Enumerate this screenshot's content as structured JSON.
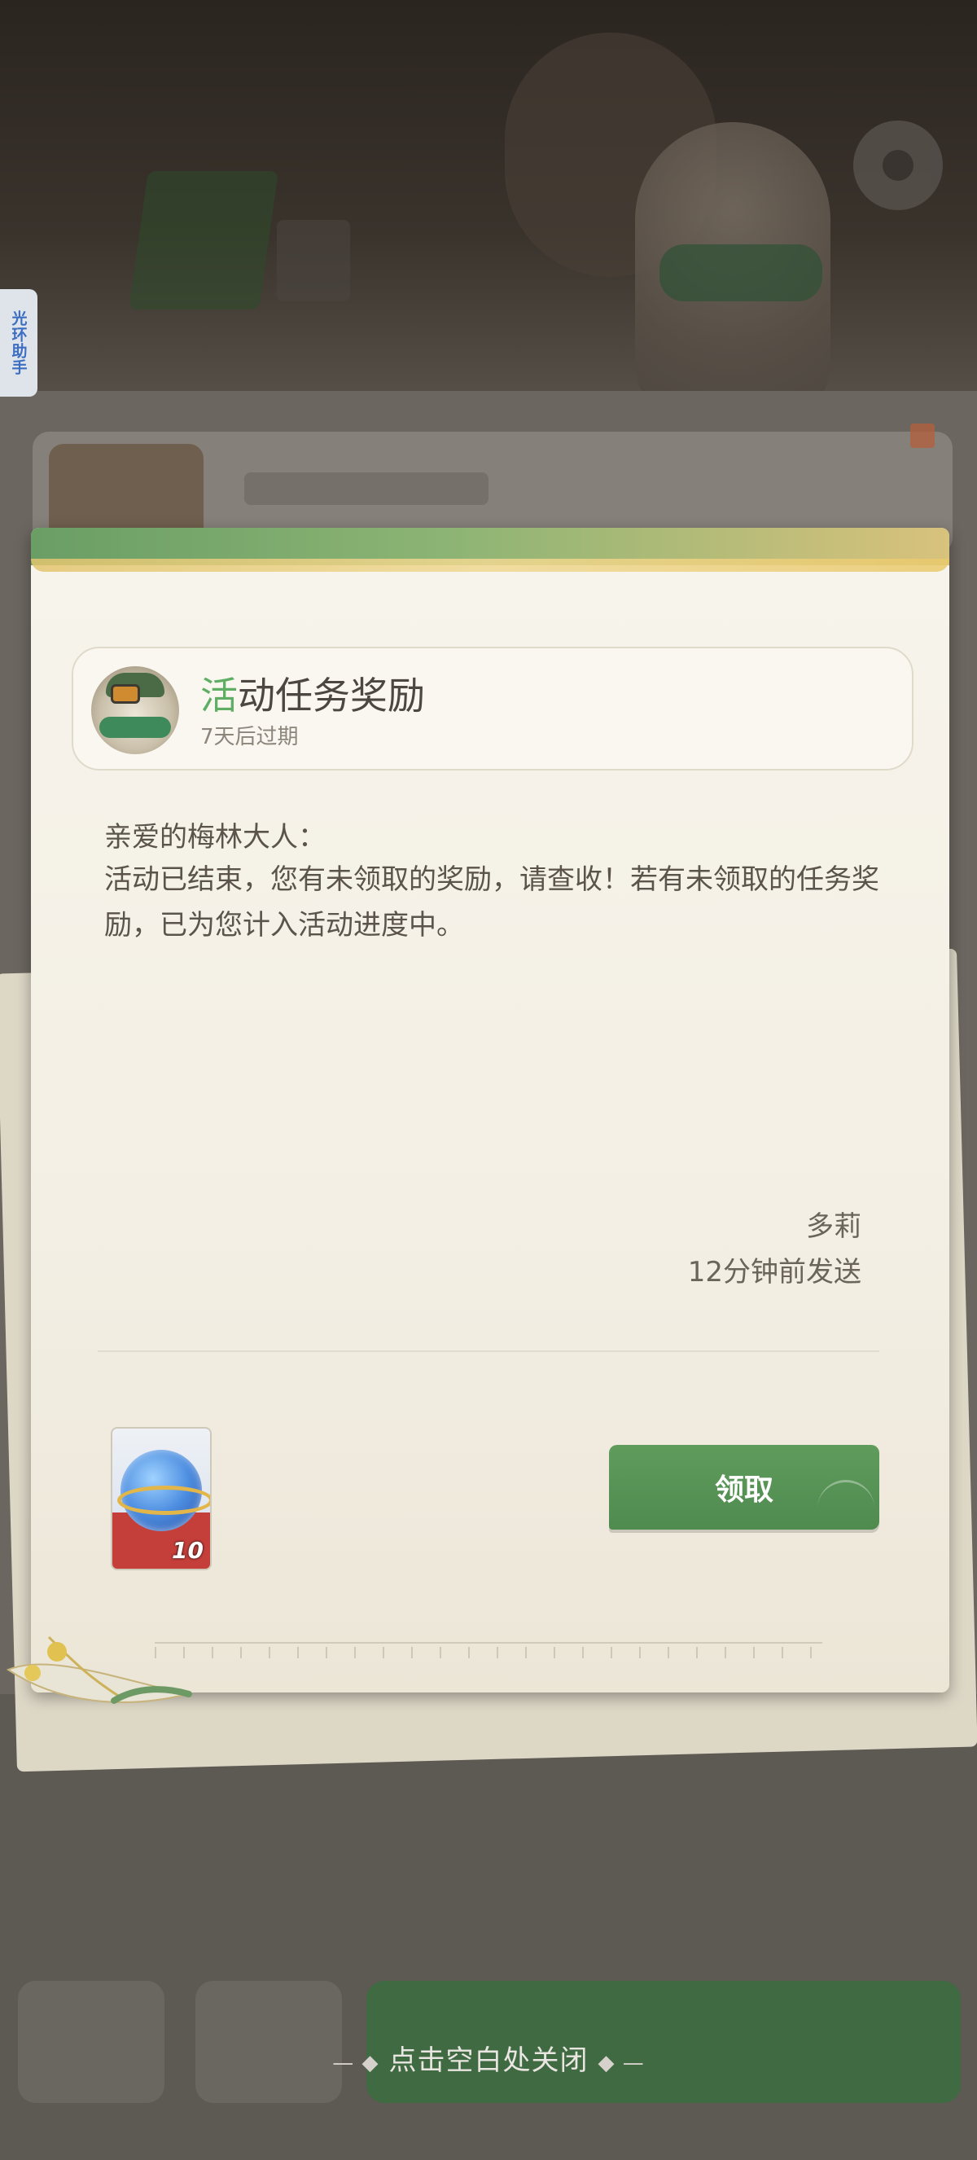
{
  "side_tab": {
    "label": "光环助手"
  },
  "letter": {
    "title_accent": "活",
    "title_rest": "动任务奖励",
    "expiry": "7天后过期",
    "greeting": "亲爱的梅林大人：",
    "body": "活动已结束，您有未领取的奖励，请查收！若有未领取的任务奖励，已为您计入活动进度中。",
    "sender": "多莉",
    "sent_time": "12分钟前发送"
  },
  "reward": {
    "icon": "crystal-orb-icon",
    "count": "10"
  },
  "claim_button": {
    "label": "领取"
  },
  "close_hint": {
    "label": "点击空白处关闭"
  },
  "colors": {
    "accent_green": "#5fae63",
    "button_green": "#4f8a4f",
    "paper": "#f5f1e7"
  }
}
